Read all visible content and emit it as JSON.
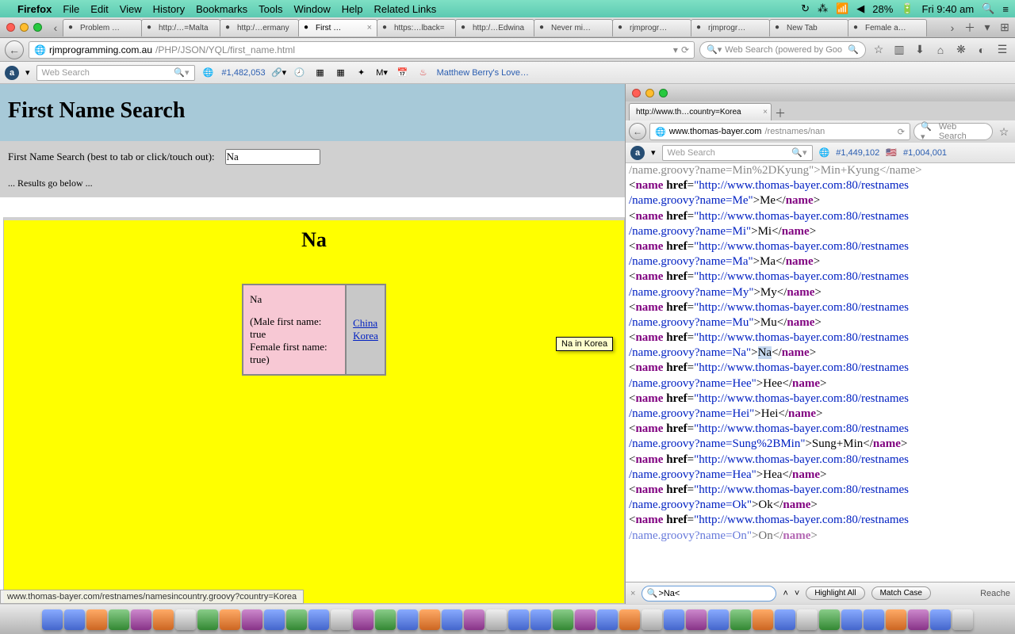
{
  "mac_menu": {
    "app": "Firefox",
    "items": [
      "File",
      "Edit",
      "View",
      "History",
      "Bookmarks",
      "Tools",
      "Window",
      "Help",
      "Related Links"
    ],
    "battery": "28%",
    "clock": "Fri 9:40 am"
  },
  "tabs": [
    {
      "label": "Problem …"
    },
    {
      "label": "http:/…=Malta"
    },
    {
      "label": "http:/…ermany"
    },
    {
      "label": "First …",
      "active": true
    },
    {
      "label": "https:…lback="
    },
    {
      "label": "http:/…Edwina"
    },
    {
      "label": "Never mi…"
    },
    {
      "label": "rjmprogr…"
    },
    {
      "label": "rjmprogr…"
    },
    {
      "label": "New Tab"
    },
    {
      "label": "Female a…"
    }
  ],
  "url": {
    "host": "rjmprogramming.com.au",
    "path": "/PHP/JSON/YQL/first_name.html"
  },
  "search_placeholder": "Web Search (powered by Goo",
  "alexa": {
    "ws_placeholder": "Web Search",
    "rank": "#1,482,053",
    "link": "Matthew Berry's Love…"
  },
  "page": {
    "title": "First Name Search",
    "form_label": "First Name Search (best to tab or click/touch out):",
    "input_value": "Na",
    "results_label": "... Results go below ...",
    "result_heading": "Na",
    "cell_name": "Na",
    "cell_male": "(Male first name: true",
    "cell_female": "Female first name: true)",
    "country_links": [
      "China",
      "Korea"
    ],
    "tooltip": "Na in Korea"
  },
  "status_bar": "www.thomas-bayer.com/restnames/namesincountry.groovy?country=Korea",
  "popup": {
    "tab_label": "http://www.th…country=Korea",
    "url_host": "www.thomas-bayer.com",
    "url_path": "/restnames/nan",
    "search_placeholder": "Web Search",
    "alexa_ws": "Web Search",
    "rank1": "#1,449,102",
    "rank2": "#1,004,001",
    "top_fragment": ">Min+Kyung</name>",
    "names": [
      {
        "q": "Me",
        "txt": "Me"
      },
      {
        "q": "Mi",
        "txt": "Mi"
      },
      {
        "q": "Ma",
        "txt": "Ma"
      },
      {
        "q": "My",
        "txt": "My"
      },
      {
        "q": "Mu",
        "txt": "Mu"
      },
      {
        "q": "Na",
        "txt": "Na",
        "hl": true
      },
      {
        "q": "Hee",
        "txt": "Hee"
      },
      {
        "q": "Hei",
        "txt": "Hei"
      },
      {
        "q": "Sung%2BMin",
        "txt": "Sung+Min"
      },
      {
        "q": "Hea",
        "txt": "Hea"
      },
      {
        "q": "Ok",
        "txt": "Ok"
      },
      {
        "q": "On",
        "txt": "On",
        "cut": true
      }
    ],
    "url_prefix": "http://www.thomas-bayer.com:80/restnames",
    "url_path_start": "/name.groovy?name=",
    "find_value": ">Na<",
    "highlight_btn": "Highlight All",
    "matchcase_btn": "Match Case",
    "reached": "Reache"
  }
}
